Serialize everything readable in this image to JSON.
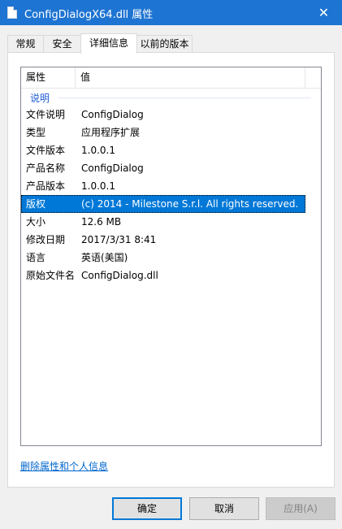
{
  "window": {
    "title": "ConfigDialogX64.dll 属性",
    "close_symbol": "✕"
  },
  "tabs": [
    {
      "label": "常规"
    },
    {
      "label": "安全"
    },
    {
      "label": "详细信息"
    },
    {
      "label": "以前的版本"
    }
  ],
  "listview": {
    "headers": {
      "property": "属性",
      "value": "值"
    },
    "group_label": "说明",
    "rows": [
      {
        "key": "文件说明",
        "value": "ConfigDialog"
      },
      {
        "key": "类型",
        "value": "应用程序扩展"
      },
      {
        "key": "文件版本",
        "value": "1.0.0.1"
      },
      {
        "key": "产品名称",
        "value": "ConfigDialog"
      },
      {
        "key": "产品版本",
        "value": "1.0.0.1"
      },
      {
        "key": "版权",
        "value": "(c) 2014 - Milestone S.r.l.  All rights reserved."
      },
      {
        "key": "大小",
        "value": "12.6 MB"
      },
      {
        "key": "修改日期",
        "value": "2017/3/31 8:41"
      },
      {
        "key": "语言",
        "value": "英语(美国)"
      },
      {
        "key": "原始文件名",
        "value": "ConfigDialog.dll"
      }
    ],
    "selected_row_index": 5
  },
  "remove_link": "删除属性和个人信息",
  "buttons": {
    "ok": "确定",
    "cancel": "取消",
    "apply": "应用(A)"
  },
  "colors": {
    "titlebar": "#1e74d2",
    "selection": "#0078d7",
    "link": "#0066cc",
    "group_label": "#1e5ad6"
  }
}
